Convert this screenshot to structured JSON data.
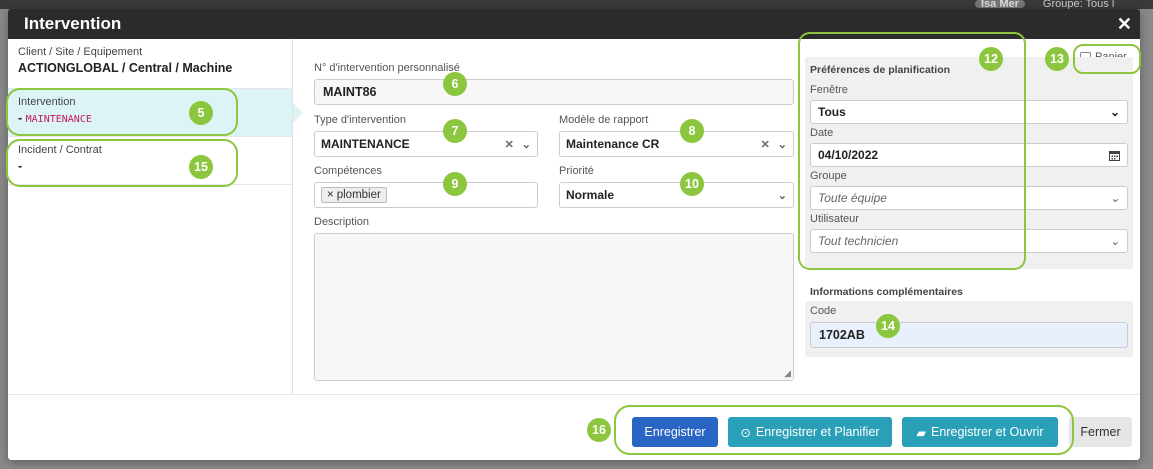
{
  "background": {
    "top_right_pill": "Isa Mer",
    "top_right_text": "Groupe: Tous l"
  },
  "modal": {
    "title": "Intervention",
    "close_glyph": "✕"
  },
  "sidebar": {
    "client_label": "Client / Site / Equipement",
    "client_value": "ACTIONGLOBAL / Central / Machine",
    "intervention_label": "Intervention",
    "intervention_prefix": "- ",
    "intervention_value": "MAINTENANCE",
    "incident_label": "Incident / Contrat",
    "incident_value": "-"
  },
  "form": {
    "numero_label": "N° d'intervention personnalisé",
    "numero_value": "MAINT86",
    "type_label": "Type d'intervention",
    "type_value": "MAINTENANCE",
    "modele_label": "Modèle de rapport",
    "modele_value": "Maintenance CR",
    "competences_label": "Compétences",
    "competences_tags": [
      "plombier"
    ],
    "priorite_label": "Priorité",
    "priorite_value": "Normale",
    "description_label": "Description",
    "description_value": ""
  },
  "planning": {
    "title": "Préférences de planification",
    "panier_label": "Panier",
    "panier_checked": false,
    "fenetre_label": "Fenêtre",
    "fenetre_value": "Tous",
    "date_label": "Date",
    "date_value": "04/10/2022",
    "groupe_label": "Groupe",
    "groupe_value": "Toute équipe",
    "utilisateur_label": "Utilisateur",
    "utilisateur_value": "Tout technicien"
  },
  "info": {
    "title": "Informations complémentaires",
    "code_label": "Code",
    "code_value": "1702AB"
  },
  "footer": {
    "save": "Enregistrer",
    "save_plan": "Enregistrer et Planifier",
    "save_open": "Enregistrer et Ouvrir",
    "close": "Fermer"
  },
  "callouts": {
    "b5": "5",
    "b6": "6",
    "b7": "7",
    "b8": "8",
    "b9": "9",
    "b10": "10",
    "b12": "12",
    "b13": "13",
    "b14": "14",
    "b15": "15",
    "b16": "16"
  },
  "colors": {
    "primary": "#2a64c4",
    "info": "#2a9fb8",
    "callout": "#8cc63f",
    "header": "#2b2b2b"
  }
}
